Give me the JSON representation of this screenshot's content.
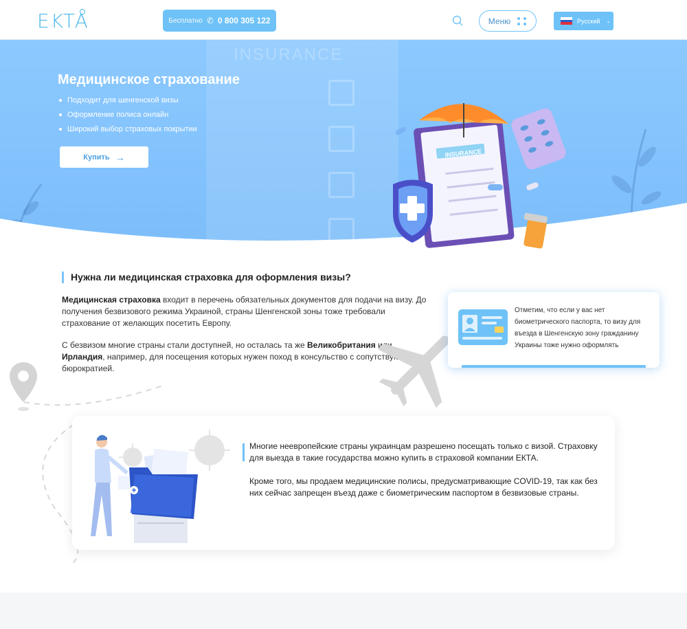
{
  "header": {
    "logo": "EKTA",
    "phone_free_label": "Бесплатно",
    "phone_number": "0 800 305 122",
    "menu_label": "Меню",
    "language_label": "Русский"
  },
  "hero": {
    "background_word": "INSURANCE",
    "title": "Медицинское страхование",
    "bullets": [
      "Подходит для шенгенской визы",
      "Оформление полиса онлайн",
      "Широкий выбор страховых покрытии"
    ],
    "buy_label": "Купить",
    "clipboard_label": "INSURANCE"
  },
  "section": {
    "title": "Нужна ли медицинская страховка для оформления визы?",
    "p1_bold": "Медицинская страховка",
    "p1_rest": " входит в перечень обязательных документов для подачи на визу. До получения безвизового режима Украиной, страны Шенгенской зоны тоже требовали страхование от желающих посетить Европу.",
    "p2_start": "С безвизом многие страны стали доступней, но осталась та же ",
    "p2_bold1": "Великобритания",
    "p2_mid": " или ",
    "p2_bold2": "Ирландия",
    "p2_end": ", например, для посещения которых нужен поход в консульство с сопутствующей бюрократией."
  },
  "info_card": {
    "text": "Отметим, что если у вас нет биометрического паспорта, то визу для въезда в Шенгенскую зону гражданину Украины тоже нужно оформлять"
  },
  "card2": {
    "p1": "Многие неевропейские страны украинцам разрешено посещать только с визой. Страховку для выезда в такие государства можно купить в страховой компании ЕКТА.",
    "p2": "Кроме того, мы продаем медицинские полисы, предусматривающие COVID-19, так как без них сейчас запрещен въезд даже с биометрическим паспортом в безвизовые страны."
  },
  "colors": {
    "accent": "#6ec2f7",
    "hero": "#8cc9ff",
    "logo": "#4db8e8"
  }
}
